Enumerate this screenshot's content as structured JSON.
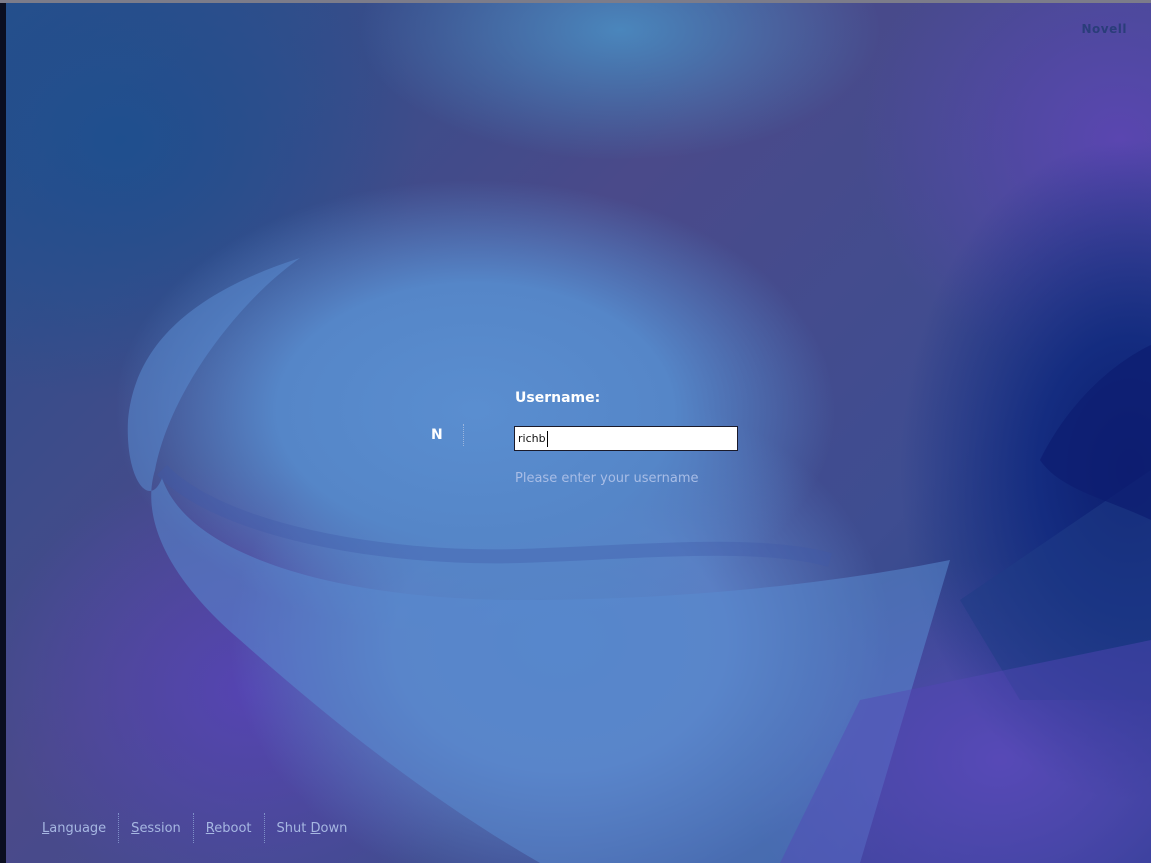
{
  "brand": "Novell",
  "logo": "N",
  "login": {
    "label": "Username:",
    "input_value": "richb",
    "hint": "Please enter your username"
  },
  "menu": {
    "language": {
      "first": "L",
      "rest": "anguage"
    },
    "session": {
      "first": "S",
      "rest": "ession"
    },
    "reboot": {
      "first": "R",
      "rest": "eboot"
    },
    "shutdown": {
      "before": "Shut ",
      "mnemonic": "D",
      "rest": "own"
    }
  },
  "colors": {
    "background": "#4a4a8a",
    "panel_light": "#5586c8",
    "text_white": "#ffffff",
    "hint_text": "#a8bde6",
    "menu_text": "#a6b7e2"
  }
}
